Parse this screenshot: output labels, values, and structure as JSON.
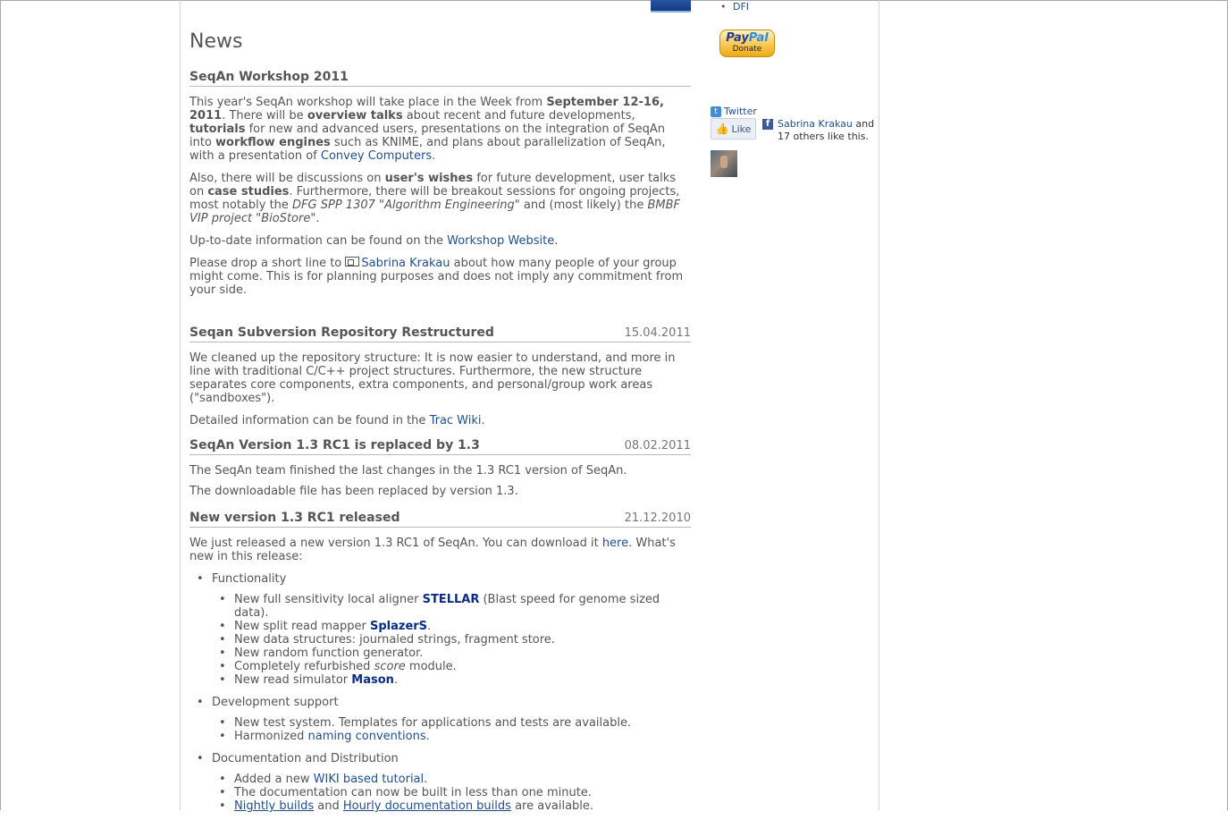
{
  "main": {
    "news_title": "News",
    "workshop": {
      "title": "SeqAn Workshop 2011",
      "p1": {
        "t1": "This year's SeqAn workshop will take place in the Week from ",
        "b1": "September 12-16, 2011",
        "t2": ". There will be ",
        "b2": "overview talks",
        "t3": " about recent and future developments, ",
        "b3": "tutorials",
        "t4": " for new and advanced users, presentations on the integration of SeqAn into ",
        "b4": "workflow engines",
        "t5": " such as KNIME, and plans about parallelization of SeqAn, with a presentation of ",
        "link": "Convey Computers",
        "t6": "."
      },
      "p2": {
        "t1": "Also, there will be discussions on ",
        "b1": "user's wishes",
        "t2": " for future development, user talks on ",
        "b2": "case studies",
        "t3": ". Furthermore, there will be breakout sessions for ongoing projects, most notably the ",
        "i1": "DFG SPP 1307 \"Algorithm Engineering\"",
        "t4": " and (most likely) the ",
        "i2": "BMBF VIP project \"BioStore\"",
        "t5": "."
      },
      "p3": {
        "t1": "Up-to-date information can be found on the ",
        "link": "Workshop Website",
        "t2": "."
      },
      "p4": {
        "t1": "Please drop a short line to ",
        "link": "Sabrina Krakau",
        "t2": " about how many people of your group might come. This is for planning purposes and does not imply any commitment from your side."
      }
    },
    "svn": {
      "title": "Seqan Subversion Repository Restructured",
      "date": "15.04.2011",
      "p1": "We cleaned up the repository structure: It is now easier to understand, and more in line with traditional C/C++ project structures. Furthermore, the new structure separates core components, extra components, and personal/group work areas (\"sandboxes\").",
      "p2": {
        "t1": "Detailed information can be found in the ",
        "link": "Trac Wiki",
        "t2": "."
      }
    },
    "v13": {
      "title": "SeqAn Version 1.3 RC1 is replaced by 1.3",
      "date": "08.02.2011",
      "p1": "The SeqAn team finished the last changes in the 1.3 RC1 version of SeqAn.",
      "p2": "The downloadable file has been replaced by version 1.3."
    },
    "rc1": {
      "title": "New version 1.3 RC1 released",
      "date": "21.12.2010",
      "p1": {
        "t1": "We just released a new version 1.3 RC1 of SeqAn. You can download it ",
        "link": "here",
        "t2": ". What's new in this release:"
      },
      "functionality": {
        "label": "Functionality",
        "i1": {
          "t1": "New full sensitivity local aligner ",
          "link": "STELLAR",
          "t2": " (Blast speed for genome sized data)."
        },
        "i2": {
          "t1": "New split read mapper ",
          "link": "SplazerS",
          "t2": "."
        },
        "i3": "New data structures: journaled strings, fragment store.",
        "i4": "New random function generator.",
        "i5": {
          "t1": "Completely refurbished ",
          "em": "score",
          "t2": " module."
        },
        "i6": {
          "t1": "New read simulator ",
          "link": "Mason",
          "t2": "."
        }
      },
      "devsupport": {
        "label": "Development support",
        "i1": "New test system. Templates for applications and tests are available.",
        "i2": {
          "t1": "Harmonized ",
          "link": "naming conventions",
          "t2": "."
        }
      },
      "docs": {
        "label": "Documentation and Distribution",
        "i1": {
          "t1": "Added a new ",
          "link": "WIKI based tutorial",
          "t2": "."
        },
        "i2": "The documentation can now be built in less than one minute.",
        "i3": {
          "link1": "Nightly builds",
          "t1": " and ",
          "link2": "Hourly documentation builds",
          "t2": " are available."
        }
      }
    }
  },
  "sidebar": {
    "dfi": "DFI",
    "paypal_brand_a": "Pay",
    "paypal_brand_b": "Pal",
    "paypal_donate": "Donate",
    "twitter": "Twitter",
    "like": "Like",
    "fb_name": "Sabrina Krakau",
    "fb_and": " and",
    "fb_others": "17 others like this."
  },
  "colors": {
    "link": "#1f4f8f",
    "strong_link": "#0a2c86",
    "text": "#555555"
  }
}
